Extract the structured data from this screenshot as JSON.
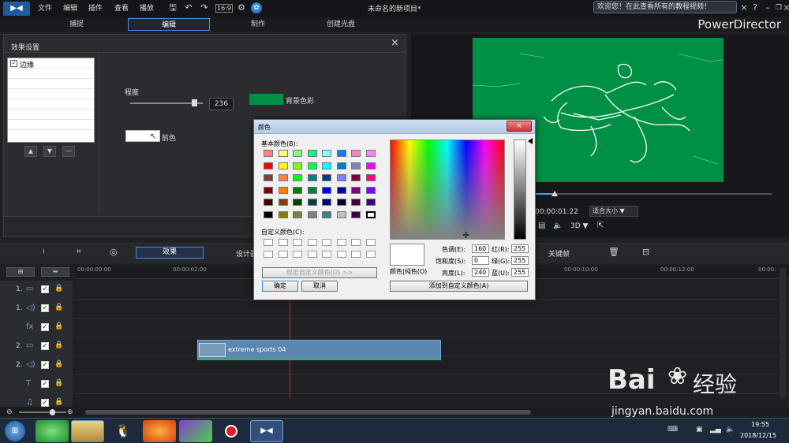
{
  "titlebar": {
    "title": "未命名的新项目*",
    "menus": [
      "文件",
      "编辑",
      "插件",
      "查看",
      "播放"
    ],
    "notify": "欢迎您！在此查看所有的教程视频！",
    "app": "PowerDirector"
  },
  "modes": [
    "捕捉",
    "编辑",
    "制作",
    "创建光盘"
  ],
  "effect_panel": {
    "title": "效果设置",
    "list": [
      "边缘"
    ],
    "degree_label": "程度",
    "degree_value": "236",
    "degree_level": 0.92,
    "fg_label": "前色",
    "bg_label": "背景色彩",
    "bg_color": "#009045"
  },
  "preview": {
    "timecode": "00:00:01:22",
    "fit": "适合大小 ▼",
    "mode3d": "3D ▼"
  },
  "timeline_toolbar": {
    "effect": "效果",
    "design": "设计器",
    "keyframe": "关键帧"
  },
  "ruler": [
    "00:00:00:00",
    "00:00:02:00",
    "00:00:10:00",
    "00:00:12:00",
    "00:00:"
  ],
  "tracks": [
    {
      "num": "1.",
      "icon": "video-track-icon"
    },
    {
      "num": "1.",
      "icon": "audio-track-icon"
    },
    {
      "num": "",
      "icon": "fx-track-icon"
    },
    {
      "num": "2.",
      "icon": "video-track-icon"
    },
    {
      "num": "2.",
      "icon": "audio-track-icon"
    },
    {
      "num": "",
      "icon": "title-track-icon"
    },
    {
      "num": "",
      "icon": "voice-track-icon"
    }
  ],
  "clip": {
    "name": "extreme sports 04"
  },
  "dialog": {
    "title": "颜色",
    "basic_label": "基本颜色(B):",
    "custom_label": "自定义颜色(C):",
    "define_btn": "规定自定义颜色(D) >>",
    "ok": "确定",
    "cancel": "取消",
    "color_label": "颜色|纯色(O)",
    "add_btn": "添加到自定义颜色(A)",
    "hue_label": "色调(E):",
    "hue": "160",
    "sat_label": "饱和度(S):",
    "sat": "0",
    "lum_label": "亮度(L):",
    "lum": "240",
    "red_label": "红(R):",
    "red": "255",
    "green_label": "绿(G):",
    "green": "255",
    "blue_label": "蓝(U):",
    "blue": "255",
    "swatches": [
      "#ff8080",
      "#ffff80",
      "#80ff80",
      "#00ff80",
      "#80ffff",
      "#0080ff",
      "#ff80c0",
      "#ff80ff",
      "#ff0000",
      "#ffff00",
      "#80ff00",
      "#00ff40",
      "#00ffff",
      "#0080c0",
      "#8080c0",
      "#ff00ff",
      "#804040",
      "#ff8040",
      "#00ff00",
      "#008080",
      "#004080",
      "#8080ff",
      "#800040",
      "#ff0080",
      "#800000",
      "#ff8000",
      "#008000",
      "#008040",
      "#0000ff",
      "#0000a0",
      "#800080",
      "#8000ff",
      "#400000",
      "#804000",
      "#004000",
      "#004040",
      "#000080",
      "#000040",
      "#400040",
      "#400080",
      "#000000",
      "#808000",
      "#808040",
      "#808080",
      "#408080",
      "#c0c0c0",
      "#400040",
      "#ffffff"
    ]
  },
  "tray": {
    "time": "19:55",
    "date": "2018/12/15"
  },
  "watermark": {
    "brand": "Bai",
    "paw": "经验",
    "url": "jingyan.baidu.com"
  }
}
